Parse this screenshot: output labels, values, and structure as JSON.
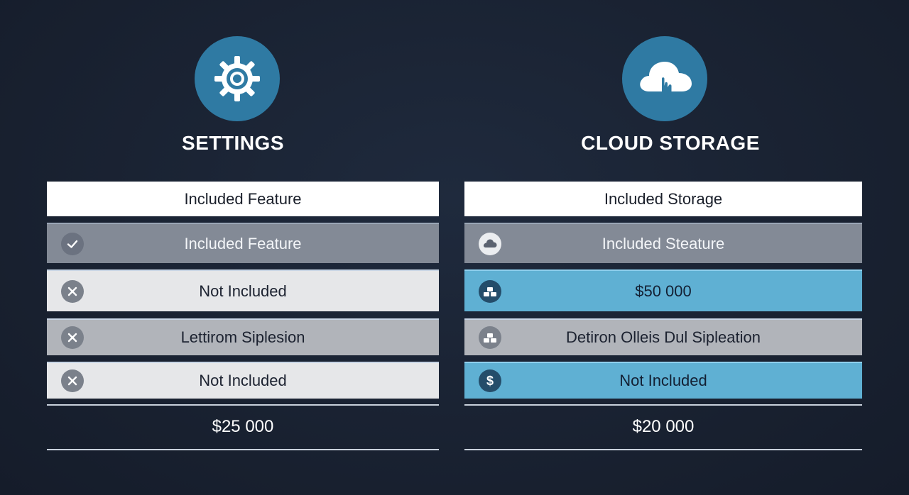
{
  "colors": {
    "background": "#1a2335",
    "icon_circle": "#2f7aa3",
    "highlight_row": "#5fb0d3"
  },
  "settings": {
    "icon": "gear-icon",
    "title": "SETTINGS",
    "header": "Included Feature",
    "rows": [
      {
        "label": "Included Feature",
        "icon": "check-icon"
      },
      {
        "label": "Not Included",
        "icon": "x-icon"
      },
      {
        "label": "Lettirom Siplesion",
        "icon": "x-icon"
      },
      {
        "label": "Not Included",
        "icon": "x-icon"
      }
    ],
    "price": "$25 000"
  },
  "cloud_storage": {
    "icon": "cloud-upload-icon",
    "title": "CLOUD STORAGE",
    "header": "Included Storage",
    "rows": [
      {
        "label": "Included Steature",
        "icon": "cloud-icon"
      },
      {
        "label": "$50 000",
        "icon": "stack-icon"
      },
      {
        "label": "Detiron Olleis Dul Sipleation",
        "icon": "stack-icon"
      },
      {
        "label": "Not Included",
        "icon": "dollar-icon"
      }
    ],
    "price": "$20 000"
  }
}
